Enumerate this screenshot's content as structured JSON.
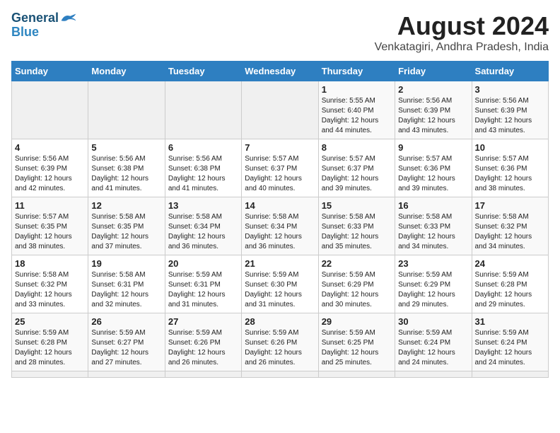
{
  "logo": {
    "line1": "General",
    "line2": "Blue"
  },
  "title": "August 2024",
  "subtitle": "Venkatagiri, Andhra Pradesh, India",
  "weekdays": [
    "Sunday",
    "Monday",
    "Tuesday",
    "Wednesday",
    "Thursday",
    "Friday",
    "Saturday"
  ],
  "days": [
    {
      "num": "",
      "info": ""
    },
    {
      "num": "",
      "info": ""
    },
    {
      "num": "",
      "info": ""
    },
    {
      "num": "",
      "info": ""
    },
    {
      "num": "1",
      "info": "Sunrise: 5:55 AM\nSunset: 6:40 PM\nDaylight: 12 hours\nand 44 minutes."
    },
    {
      "num": "2",
      "info": "Sunrise: 5:56 AM\nSunset: 6:39 PM\nDaylight: 12 hours\nand 43 minutes."
    },
    {
      "num": "3",
      "info": "Sunrise: 5:56 AM\nSunset: 6:39 PM\nDaylight: 12 hours\nand 43 minutes."
    },
    {
      "num": "4",
      "info": "Sunrise: 5:56 AM\nSunset: 6:39 PM\nDaylight: 12 hours\nand 42 minutes."
    },
    {
      "num": "5",
      "info": "Sunrise: 5:56 AM\nSunset: 6:38 PM\nDaylight: 12 hours\nand 41 minutes."
    },
    {
      "num": "6",
      "info": "Sunrise: 5:56 AM\nSunset: 6:38 PM\nDaylight: 12 hours\nand 41 minutes."
    },
    {
      "num": "7",
      "info": "Sunrise: 5:57 AM\nSunset: 6:37 PM\nDaylight: 12 hours\nand 40 minutes."
    },
    {
      "num": "8",
      "info": "Sunrise: 5:57 AM\nSunset: 6:37 PM\nDaylight: 12 hours\nand 39 minutes."
    },
    {
      "num": "9",
      "info": "Sunrise: 5:57 AM\nSunset: 6:36 PM\nDaylight: 12 hours\nand 39 minutes."
    },
    {
      "num": "10",
      "info": "Sunrise: 5:57 AM\nSunset: 6:36 PM\nDaylight: 12 hours\nand 38 minutes."
    },
    {
      "num": "11",
      "info": "Sunrise: 5:57 AM\nSunset: 6:35 PM\nDaylight: 12 hours\nand 38 minutes."
    },
    {
      "num": "12",
      "info": "Sunrise: 5:58 AM\nSunset: 6:35 PM\nDaylight: 12 hours\nand 37 minutes."
    },
    {
      "num": "13",
      "info": "Sunrise: 5:58 AM\nSunset: 6:34 PM\nDaylight: 12 hours\nand 36 minutes."
    },
    {
      "num": "14",
      "info": "Sunrise: 5:58 AM\nSunset: 6:34 PM\nDaylight: 12 hours\nand 36 minutes."
    },
    {
      "num": "15",
      "info": "Sunrise: 5:58 AM\nSunset: 6:33 PM\nDaylight: 12 hours\nand 35 minutes."
    },
    {
      "num": "16",
      "info": "Sunrise: 5:58 AM\nSunset: 6:33 PM\nDaylight: 12 hours\nand 34 minutes."
    },
    {
      "num": "17",
      "info": "Sunrise: 5:58 AM\nSunset: 6:32 PM\nDaylight: 12 hours\nand 34 minutes."
    },
    {
      "num": "18",
      "info": "Sunrise: 5:58 AM\nSunset: 6:32 PM\nDaylight: 12 hours\nand 33 minutes."
    },
    {
      "num": "19",
      "info": "Sunrise: 5:58 AM\nSunset: 6:31 PM\nDaylight: 12 hours\nand 32 minutes."
    },
    {
      "num": "20",
      "info": "Sunrise: 5:59 AM\nSunset: 6:31 PM\nDaylight: 12 hours\nand 31 minutes."
    },
    {
      "num": "21",
      "info": "Sunrise: 5:59 AM\nSunset: 6:30 PM\nDaylight: 12 hours\nand 31 minutes."
    },
    {
      "num": "22",
      "info": "Sunrise: 5:59 AM\nSunset: 6:29 PM\nDaylight: 12 hours\nand 30 minutes."
    },
    {
      "num": "23",
      "info": "Sunrise: 5:59 AM\nSunset: 6:29 PM\nDaylight: 12 hours\nand 29 minutes."
    },
    {
      "num": "24",
      "info": "Sunrise: 5:59 AM\nSunset: 6:28 PM\nDaylight: 12 hours\nand 29 minutes."
    },
    {
      "num": "25",
      "info": "Sunrise: 5:59 AM\nSunset: 6:28 PM\nDaylight: 12 hours\nand 28 minutes."
    },
    {
      "num": "26",
      "info": "Sunrise: 5:59 AM\nSunset: 6:27 PM\nDaylight: 12 hours\nand 27 minutes."
    },
    {
      "num": "27",
      "info": "Sunrise: 5:59 AM\nSunset: 6:26 PM\nDaylight: 12 hours\nand 26 minutes."
    },
    {
      "num": "28",
      "info": "Sunrise: 5:59 AM\nSunset: 6:26 PM\nDaylight: 12 hours\nand 26 minutes."
    },
    {
      "num": "29",
      "info": "Sunrise: 5:59 AM\nSunset: 6:25 PM\nDaylight: 12 hours\nand 25 minutes."
    },
    {
      "num": "30",
      "info": "Sunrise: 5:59 AM\nSunset: 6:24 PM\nDaylight: 12 hours\nand 24 minutes."
    },
    {
      "num": "31",
      "info": "Sunrise: 5:59 AM\nSunset: 6:24 PM\nDaylight: 12 hours\nand 24 minutes."
    },
    {
      "num": "",
      "info": ""
    },
    {
      "num": "",
      "info": ""
    },
    {
      "num": "",
      "info": ""
    },
    {
      "num": "",
      "info": ""
    },
    {
      "num": "",
      "info": ""
    },
    {
      "num": "",
      "info": ""
    },
    {
      "num": "",
      "info": ""
    }
  ]
}
